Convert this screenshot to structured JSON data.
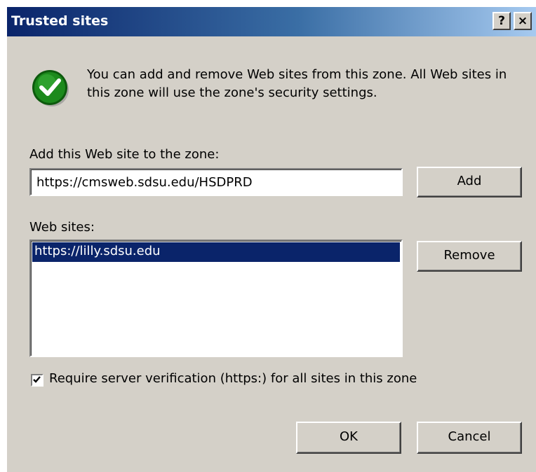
{
  "window": {
    "title": "Trusted sites",
    "help_label": "?",
    "close_label": "×"
  },
  "info": {
    "text": "You can add and remove Web sites from this zone. All Web sites in this zone will use the zone's security settings."
  },
  "add_section": {
    "label": "Add this Web site to the zone:",
    "value": "https://cmsweb.sdsu.edu/HSDPRD",
    "add_label": "Add"
  },
  "sites_section": {
    "label": "Web sites:",
    "items": [
      {
        "label": "https://lilly.sdsu.edu",
        "selected": true
      }
    ],
    "remove_label": "Remove"
  },
  "verification": {
    "label": "Require server verification (https:) for all sites in this zone",
    "checked": true
  },
  "footer": {
    "ok_label": "OK",
    "cancel_label": "Cancel"
  },
  "colors": {
    "dialog_bg": "#d4d0c8",
    "title_gradient_start": "#0a246a",
    "title_gradient_end": "#a6caf0",
    "selection": "#0a246a",
    "icon_green": "#1c8a1c"
  },
  "icons": {
    "info_icon": "checkmark-circle-icon",
    "checkbox_mark": "checkmark-icon"
  }
}
